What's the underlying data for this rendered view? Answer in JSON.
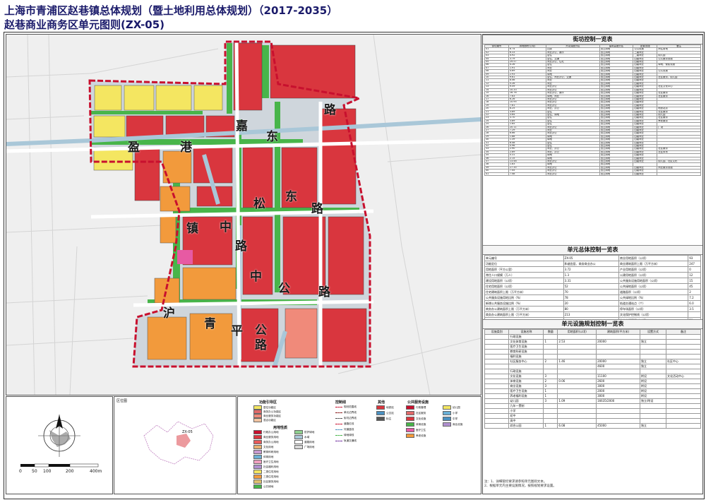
{
  "title_line1": "上海市青浦区赵巷镇总体规划（暨土地利用总体规划）（2017-2035）",
  "title_line2": "赵巷商业商务区单元图则(ZX-05)",
  "map": {
    "road_labels": [
      "路",
      "嘉",
      "东",
      "盈",
      "港",
      "东",
      "松",
      "路",
      "镇",
      "中",
      "路",
      "中",
      "公",
      "路",
      "沪",
      "青",
      "平",
      "公",
      "路"
    ],
    "inset_label": "ZX-05",
    "inset_title": "区位图"
  },
  "scale": {
    "ticks": [
      "0",
      "50",
      "100",
      "200",
      "400m"
    ]
  },
  "panel": {
    "street_table_title": "街坊控制一览表",
    "street_headers": [
      "街坊编号",
      "用地面积(公顷)",
      "开发强度分区",
      "建筑高度分区",
      "配置设施",
      "备注"
    ],
    "street_rows": [
      [
        "01",
        "6.74",
        "四类",
        "出让用地",
        "公共设施",
        "商住用地"
      ],
      [
        "02",
        "6.33",
        "商业办公、娱乐",
        "出让用地",
        "三级商业",
        ""
      ],
      [
        "03",
        "4.92",
        "居住",
        "出让用地",
        "二级商业",
        "幼儿园"
      ],
      [
        "04",
        "3.79",
        "居住、交通",
        "出让用地",
        "四级商业",
        "公共服务设施"
      ],
      [
        "05",
        "29.57",
        "商业办公、住宅",
        "出让用地",
        "四级商业",
        ""
      ],
      [
        "06",
        "4.26",
        "居住",
        "出让用地",
        "四级商业",
        "绿地、便民设施"
      ],
      [
        "07",
        "1.91",
        "商业",
        "出让用地",
        "四级商业",
        ""
      ],
      [
        "08",
        "4.69",
        "商业",
        "出让用地",
        "四级商业",
        "公共设施"
      ],
      [
        "09",
        "2.93",
        "绿地",
        "出让用地",
        "四级商业",
        ""
      ],
      [
        "10",
        "9.61",
        "居住、商业办公、交通",
        "出让用地",
        "四级商业",
        "社区服务、幼儿园"
      ],
      [
        "11",
        "8.46",
        "商业",
        "出让用地",
        "四级商业",
        ""
      ],
      [
        "12",
        "5.26",
        "商业",
        "出让用地",
        "四级商业",
        ""
      ],
      [
        "13",
        "9.59",
        "商业办公",
        "出让用地",
        "四级商业",
        "社区文化中心"
      ],
      [
        "14",
        "10.33",
        "商业办公",
        "出让用地",
        "四级商业",
        ""
      ],
      [
        "15",
        "16.76",
        "商业办公、娱乐",
        "出让用地",
        "四级商业",
        "社区服务"
      ],
      [
        "16",
        "7.63",
        "绿地、商业",
        "出让用地",
        "四级商业",
        "社区服务"
      ],
      [
        "17",
        "6.26",
        "商业办公",
        "出让用地",
        "四级商业",
        ""
      ],
      [
        "18",
        "10.95",
        "商业办公",
        "出让用地",
        "四级商业",
        ""
      ],
      [
        "19",
        "7.81",
        "商业办公",
        "出让用地",
        "四级商业",
        ""
      ],
      [
        "20",
        "8.25",
        "商业、办公",
        "出让用地",
        "四级商业",
        "地铁站点"
      ],
      [
        "21",
        "3.89",
        "居住",
        "出让用地",
        "四级商业",
        "社区服务"
      ],
      [
        "22",
        "3.64",
        "居住、绿地",
        "出让用地",
        "四级商业",
        "幼儿园"
      ],
      [
        "23",
        "3.70",
        "居住",
        "出让用地",
        "四级商业",
        "社区服务"
      ],
      [
        "24",
        "3.89",
        "居住",
        "出让用地",
        "四级商业",
        "养老服务"
      ],
      [
        "25",
        "1.65",
        "居住",
        "出让用地",
        "四级商业",
        ""
      ],
      [
        "26",
        "20.11",
        "商业办公",
        "出让用地",
        "四级商业",
        "广场"
      ],
      [
        "27",
        "7.29",
        "商业",
        "出让用地",
        "四级商业",
        ""
      ],
      [
        "28",
        "6.66",
        "商业办公",
        "出让用地",
        "四级商业",
        ""
      ],
      [
        "29",
        "1.88",
        "绿地",
        "出让用地",
        "四级商业",
        ""
      ],
      [
        "30",
        "1.39",
        "绿地",
        "出让用地",
        "四级商业",
        ""
      ],
      [
        "31",
        "6.48",
        "居住",
        "出让用地",
        "四级商业",
        ""
      ],
      [
        "32",
        "0.96",
        "居住",
        "出让用地",
        "四级商业",
        ""
      ],
      [
        "33",
        "2.90",
        "商业、办公",
        "出让用地",
        "四级商业",
        "社区服务"
      ],
      [
        "34",
        "2.89",
        "商业、办公",
        "出让用地",
        "四级商业",
        "社区体育"
      ],
      [
        "35",
        "0.31",
        "绿地",
        "出让用地",
        "四级商业",
        ""
      ],
      [
        "36",
        "2.15",
        "绿地",
        "出让用地",
        "四级商业",
        ""
      ],
      [
        "37",
        "13.48",
        "商业办公",
        "出让用地",
        "四级商业",
        "幼儿园、社区文化"
      ],
      [
        "38",
        "1.83",
        "绿地",
        "出让用地",
        "",
        ""
      ],
      [
        "39",
        "27.35",
        "商业办公",
        "出让用地",
        "四级商业",
        "商业服务设施"
      ],
      [
        "40",
        "7.45",
        "商业办公",
        "出让用地",
        "四级商业",
        ""
      ],
      [
        "41",
        "7.48",
        "商业办公",
        "出让用地",
        "四级商业",
        ""
      ]
    ],
    "overall_table_title": "单元总体控制一览表",
    "overall_rows": [
      [
        "单元编号",
        "ZX-05",
        "商业用地面积（公顷）",
        "93"
      ],
      [
        "功能定位",
        "和谐宜居、商务商业办公",
        "商业建筑面积上限（万平方米）",
        "247"
      ],
      [
        "用地面积（平方公里）",
        "3.72",
        "产业用地面积（公顷）",
        "0"
      ],
      [
        "常住人口规模（万人）",
        "1.3",
        "公建用地面积（公顷）",
        "12"
      ],
      [
        "建设用地面积（公顷）",
        "3.31",
        "公共服务设施用地面积（公顷）",
        "15"
      ],
      [
        "住宅用地面积（公顷）",
        "52",
        "公共绿地面积（公顷）",
        "45"
      ],
      [
        "住宅建筑面积上限（万平方米）",
        "70",
        "道路面积（公顷）",
        "2"
      ],
      [
        "公共服务设施用地比例（%）",
        "78",
        "公共绿地比例（%）",
        "7.2"
      ],
      [
        "新增公共服务设施比例（%）",
        "20",
        "轨道交通站点（个）",
        "6.0"
      ],
      [
        "商务办公建筑面积上限（万平方米）",
        "80",
        "停车场面积（公顷）",
        "3.5"
      ],
      [
        "商务办公建筑面积上限（万平方米）",
        "213",
        "文化保护控制线（公顷）",
        ""
      ],
      [
        "",
        "",
        "生态空间面积（公顷）",
        "20"
      ]
    ],
    "facility_table_title": "单元设施规划控制一览表",
    "facility_headers": [
      "设施类别",
      "设施名称",
      "数量",
      "用地面积(公顷)",
      "建筑面积(平方米)",
      "设置方式",
      "备注"
    ],
    "facility_rows": [
      [
        "",
        "行政设施",
        "",
        "",
        "",
        "",
        ""
      ],
      [
        "",
        "文化体育设施",
        "1",
        "2.53",
        "20000",
        "独立",
        ""
      ],
      [
        "",
        "医疗卫生设施",
        "",
        "",
        "",
        "",
        ""
      ],
      [
        "",
        "教育科研设施",
        "",
        "",
        "",
        "",
        ""
      ],
      [
        "",
        "福利设施",
        "",
        "",
        "",
        "",
        ""
      ],
      [
        "",
        "社区服务中心",
        "2",
        "1.46",
        "20000",
        "独立",
        "社区中心"
      ],
      [
        "",
        "",
        "",
        "",
        "4600",
        "独立",
        ""
      ],
      [
        "",
        "行政设施",
        "",
        "",
        "",
        "",
        ""
      ],
      [
        "",
        "文化设施",
        "3",
        "",
        "11100",
        "附设",
        "文化活动中心"
      ],
      [
        "",
        "体育设施",
        "2",
        "0.06",
        "2600",
        "附设",
        ""
      ],
      [
        "",
        "商业设施",
        "3",
        "",
        "3000",
        "附设",
        ""
      ],
      [
        "",
        "医疗卫生设施",
        "1",
        "",
        "2000",
        "附设",
        ""
      ],
      [
        "",
        "养老福利设施",
        "1",
        "",
        "3000",
        "附设",
        ""
      ],
      [
        "",
        "幼儿园",
        "3",
        "1.09",
        "16635/2000",
        "独立/附设",
        ""
      ],
      [
        "",
        "九年一贯制",
        "",
        "",
        "",
        "",
        ""
      ],
      [
        "",
        "小学",
        "",
        "",
        "",
        "",
        ""
      ],
      [
        "",
        "初中",
        "",
        "",
        "",
        "",
        ""
      ],
      [
        "",
        "高中",
        "",
        "",
        "",
        "",
        ""
      ],
      [
        "",
        "综合公园",
        "1",
        "6.08",
        "45000",
        "独立",
        ""
      ]
    ],
    "notes": [
      "注：1、详细管控要求请参照单元图则文本。",
      "2、根据单元内主要设施情况，按照规划要求设置。"
    ]
  },
  "legend": {
    "col1_title": "功能引导区",
    "col1_items": [
      "居住功能区",
      "商务办公功能区",
      "商业服务功能区",
      "混合功能区"
    ],
    "col1b_title": "用地性质",
    "col1b_items": [
      "行政办公用地",
      "商业服务用地",
      "商务办公用地",
      "文化用地",
      "教育科研用地",
      "体育用地",
      "医疗卫生用地",
      "社会福利用地",
      "二类住宅用地",
      "三类住宅用地",
      "社区服务用地",
      "公共绿地",
      "防护绿地",
      "水域",
      "道路用地",
      "广场用地"
    ],
    "col2_title": "控制线",
    "col2_items": [
      "规划范围线",
      "单元边界线",
      "街坊边界线",
      "道路红线",
      "河道蓝线",
      "绿地绿线",
      "轨道交通线"
    ],
    "col3_title": "其他",
    "col3_items": [
      "地铁站",
      "公交站",
      "标注"
    ],
    "col4_title": "公共服务设施",
    "col4_items": [
      "行政管理",
      "社区服务",
      "文化设施",
      "体育设施",
      "医疗卫生",
      "养老设施",
      "幼儿园",
      "小学",
      "中学",
      "商业设施"
    ]
  },
  "colors": {
    "commercial": "#d9363e",
    "residential_yellow": "#f4e661",
    "residential_orange": "#f29a3c",
    "green": "#48b54a",
    "water": "#a9c7d8",
    "boundary": "#c8102e",
    "pink": "#e75aa3"
  }
}
